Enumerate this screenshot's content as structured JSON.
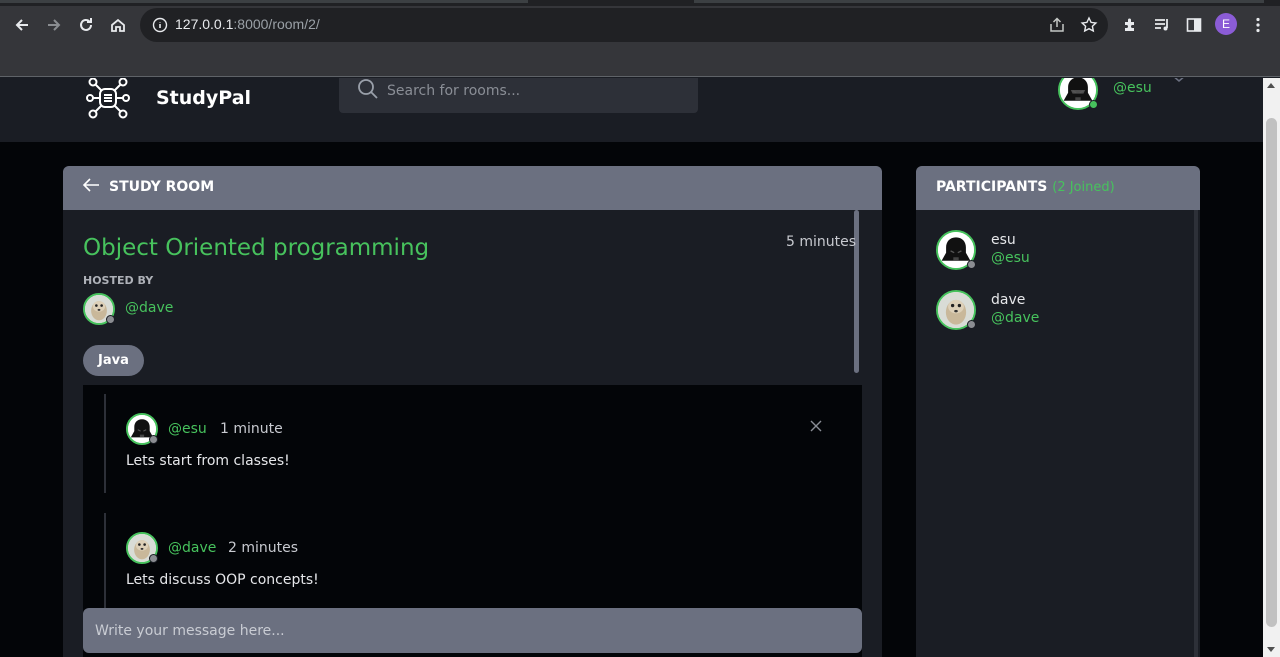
{
  "browser": {
    "url_host": "127.0.0.1",
    "url_path": ":8000/room/2/",
    "profile_initial": "E"
  },
  "header": {
    "brand": "StudyPal",
    "search_placeholder": "Search for rooms...",
    "user_name": "esu",
    "user_handle": "@esu"
  },
  "room": {
    "section_title": "STUDY ROOM",
    "name": "Object Oriented programming",
    "created": "5 minutes",
    "hosted_by_label": "HOSTED BY",
    "host_handle": "@dave",
    "topic": "Java",
    "messages": [
      {
        "handle": "@esu",
        "time": "1 minute",
        "body": "Lets start from classes!",
        "avatar": "vader-avatar",
        "deletable": true
      },
      {
        "handle": "@dave",
        "time": "2 minutes",
        "body": "Lets discuss OOP concepts!",
        "avatar": "meerkat-avatar",
        "deletable": false
      }
    ],
    "composer_placeholder": "Write your message here..."
  },
  "participants": {
    "title": "PARTICIPANTS",
    "count": "(2 Joined)",
    "items": [
      {
        "name": "esu",
        "handle": "@esu",
        "avatar": "vader-avatar"
      },
      {
        "name": "dave",
        "handle": "@dave",
        "avatar": "meerkat-avatar"
      }
    ]
  },
  "colors": {
    "accent": "#47c25d",
    "panel": "#1a1d24",
    "panel_header": "#6b7080",
    "page_bg": "#030508"
  }
}
